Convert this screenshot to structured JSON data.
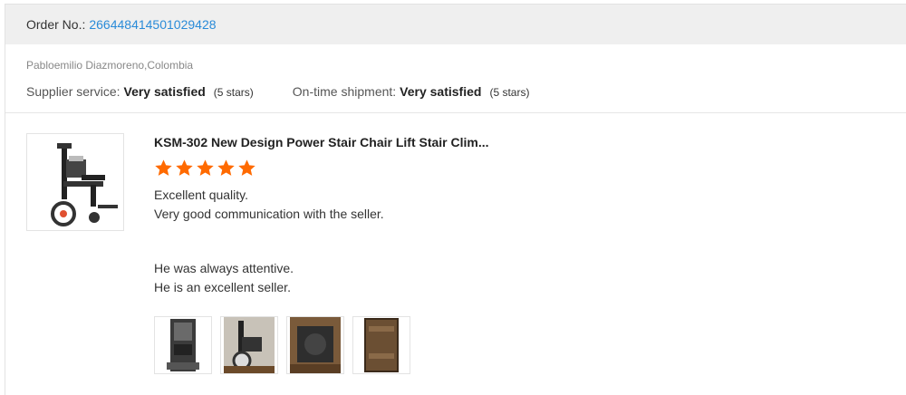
{
  "order": {
    "label": "Order No.:",
    "number": "266448414501029428"
  },
  "buyer": {
    "name": "Pabloemilio Diazmoreno,Colombia"
  },
  "ratings": {
    "supplier_label": "Supplier service:",
    "supplier_value": "Very satisfied",
    "supplier_stars": "(5 stars)",
    "shipment_label": "On-time shipment:",
    "shipment_value": "Very satisfied",
    "shipment_stars": "(5 stars)"
  },
  "review": {
    "product_title": "KSM-302 New Design Power Stair Chair Lift Stair Clim...",
    "star_rating": 5,
    "star_max": 5,
    "star_color": "#ff6a00",
    "line1": "Excellent quality.",
    "line2": "Very good communication with the seller.",
    "line3": "He was always attentive.",
    "line4": "He is an excellent seller."
  },
  "colors": {
    "link": "#2a8bd8",
    "header_bg": "#efefef"
  }
}
